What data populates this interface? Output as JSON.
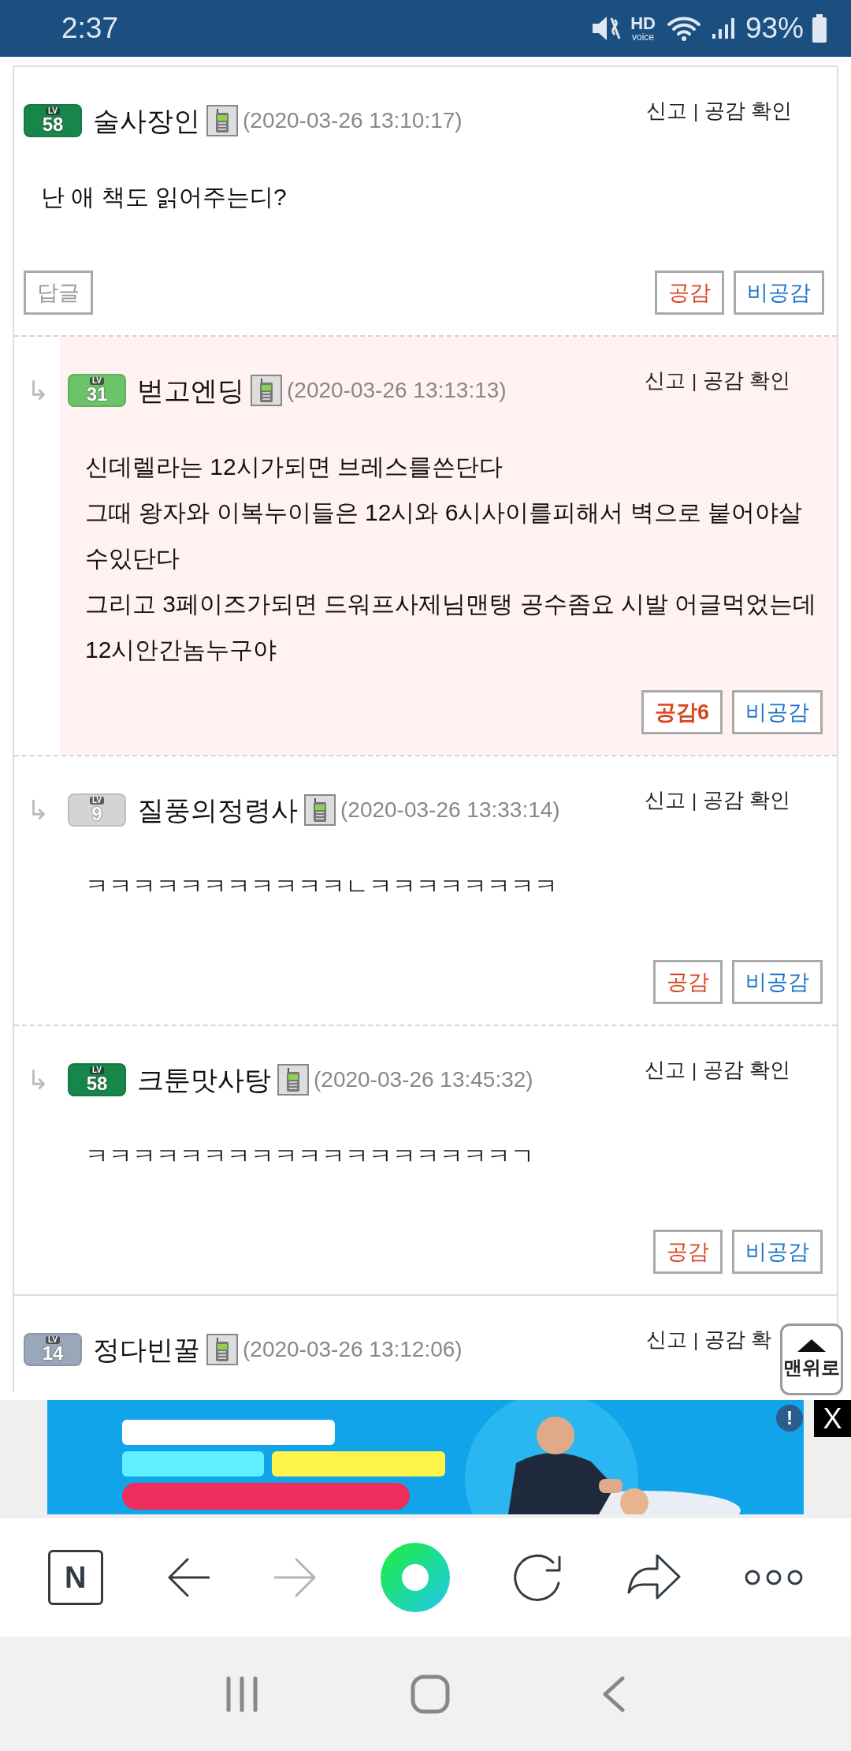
{
  "status_bar": {
    "time": "2:37",
    "hd": "HD",
    "voice": "voice",
    "battery": "93%"
  },
  "comments": [
    {
      "reply": false,
      "highlighted": false,
      "badge": {
        "label": "LV",
        "number": "58",
        "color": "#17864a"
      },
      "author": "술사장인",
      "time": "(2020-03-26 13:10:17)",
      "report": "신고",
      "separator": "|",
      "check": "공감 확인",
      "body": [
        "난 애 책도 읽어주는디?"
      ],
      "buttons": [
        {
          "kind": "reply",
          "label": "답글"
        },
        {
          "kind": "like",
          "label": "공감"
        },
        {
          "kind": "dislike",
          "label": "비공감"
        }
      ]
    },
    {
      "reply": true,
      "arrow": "↳",
      "highlighted": true,
      "badge": {
        "label": "LV",
        "number": "31",
        "color": "#6cc36a"
      },
      "author": "벋고엔딩",
      "time": "(2020-03-26 13:13:13)",
      "report": "신고",
      "separator": "|",
      "check": "공감 확인",
      "body": [
        "신데렐라는 12시가되면 브레스를쓴단다",
        "그때 왕자와 이복누이들은 12시와 6시사이를피해서 벽으로 붙어야살수있단다",
        "그리고 3페이즈가되면 드워프사제님맨탱 공수좀요 시발 어글먹었는데 12시안간놈누구야"
      ],
      "buttons": [
        {
          "kind": "like",
          "label": "공감6",
          "bold": true
        },
        {
          "kind": "dislike",
          "label": "비공감"
        }
      ]
    },
    {
      "reply": true,
      "arrow": "↳",
      "highlighted": false,
      "badge": {
        "label": "LV",
        "number": "9",
        "color": "#d4d4d4"
      },
      "author": "질풍의정령사",
      "time": "(2020-03-26 13:33:14)",
      "report": "신고",
      "separator": "|",
      "check": "공감 확인",
      "body": [
        "ㅋㅋㅋㅋㅋㅋㅋㅋㅋㅋㅋㄴㅋㅋㅋㅋㅋㅋㅋㅋ"
      ],
      "buttons": [
        {
          "kind": "like",
          "label": "공감"
        },
        {
          "kind": "dislike",
          "label": "비공감"
        }
      ]
    },
    {
      "reply": true,
      "arrow": "↳",
      "highlighted": false,
      "badge": {
        "label": "LV",
        "number": "58",
        "color": "#17864a"
      },
      "author": "크툰맛사탕",
      "time": "(2020-03-26 13:45:32)",
      "report": "신고",
      "separator": "|",
      "check": "공감 확인",
      "body": [
        "ㅋㅋㅋㅋㅋㅋㅋㅋㅋㅋㅋㅋㅋㅋㅋㅋㅋㅋㄱ"
      ],
      "buttons": [
        {
          "kind": "like",
          "label": "공감"
        },
        {
          "kind": "dislike",
          "label": "비공감"
        }
      ]
    },
    {
      "reply": false,
      "highlighted": false,
      "badge": {
        "label": "LV",
        "number": "14",
        "color": "#9aa7b8"
      },
      "author": "정다빈꿀",
      "time": "(2020-03-26 13:12:06)",
      "report": "신고",
      "separator": "|",
      "check": "공감 확"
    }
  ],
  "top_button": {
    "label": "맨위로"
  },
  "ad": {
    "kind": "picture",
    "info": "!",
    "close": "X"
  },
  "toolbar": {
    "logo": "N"
  }
}
